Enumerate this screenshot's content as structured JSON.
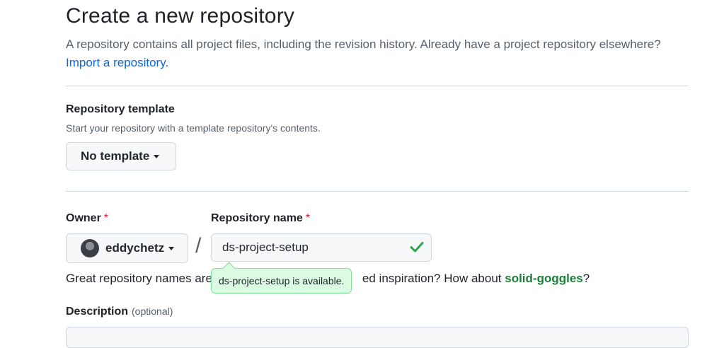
{
  "page_title": "Create a new repository",
  "lead": {
    "text": "A repository contains all project files, including the revision history. Already have a project repository elsewhere?",
    "link": "Import a repository."
  },
  "template": {
    "title": "Repository template",
    "note": "Start your repository with a template repository's contents.",
    "dropdown_label": "No template"
  },
  "owner": {
    "label": "Owner",
    "required_mark": "*",
    "value": "eddychetz"
  },
  "separator": "/",
  "repo_name": {
    "label": "Repository name",
    "required_mark": "*",
    "value": "ds-project-setup"
  },
  "availability_tooltip": "ds-project-setup is available.",
  "hint": {
    "prefix": "Great repository names are",
    "middle": "ed inspiration? How about",
    "suggestion": "solid-goggles",
    "suffix": "?"
  },
  "description": {
    "label": "Description",
    "optional": "(optional)"
  },
  "colors": {
    "link": "#0969da",
    "success": "#1a7f37",
    "required": "#cf222e",
    "tooltip_bg": "#dafbe1"
  }
}
